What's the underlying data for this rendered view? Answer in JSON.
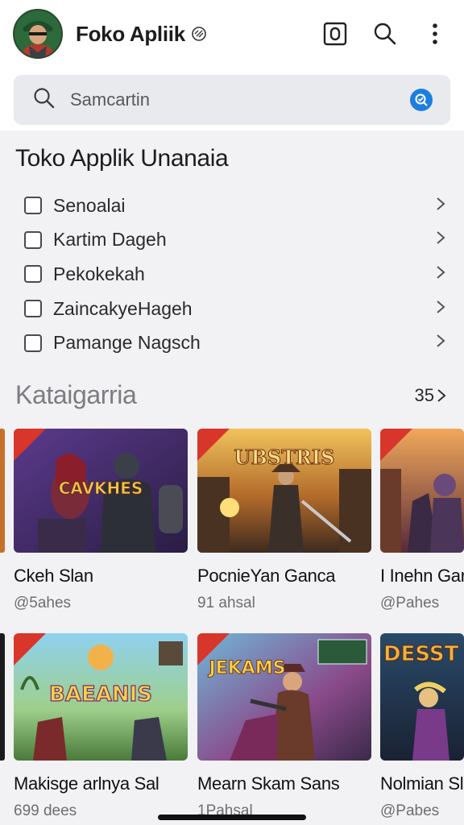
{
  "header": {
    "title": "Foko Apliik",
    "icons": [
      "camera-icon",
      "search-icon",
      "more-vert-icon"
    ]
  },
  "search": {
    "placeholder": "Samcartin",
    "badge_color": "#1d7ee0"
  },
  "section": {
    "title": "Toko Applik Unanaia",
    "items": [
      {
        "label": "Senoalai"
      },
      {
        "label": "Kartim Dageh"
      },
      {
        "label": "Pekokekah"
      },
      {
        "label": "ZaincakyeHageh"
      },
      {
        "label": "Pamange Nagsch"
      }
    ]
  },
  "category": {
    "title": "Kataigarria",
    "count": "35"
  },
  "games_row1": [
    {
      "title": "Ckeh Slan",
      "meta": "@5ahes",
      "thumb_text": "CAVKHES"
    },
    {
      "title": "PocnieYan Ganca",
      "meta": "91 ahsal",
      "thumb_text": "UBSTRIS"
    },
    {
      "title": "I Inehn Gar",
      "meta": "@Pahes",
      "thumb_text": ""
    }
  ],
  "games_row2": [
    {
      "title": "Makisge arlnya Sal",
      "meta": "699 dees",
      "thumb_text": "BAEANIS"
    },
    {
      "title": "Mearn Skam Sans",
      "meta": "1Pahsal",
      "thumb_text": "JEKAMS"
    },
    {
      "title": "Nolmian Sl",
      "meta": "@Pabes",
      "thumb_text": "DESST"
    }
  ],
  "colors": {
    "accent": "#1d7ee0",
    "panel_bg": "#f2f2f4",
    "ribbon": "#d9362b"
  }
}
